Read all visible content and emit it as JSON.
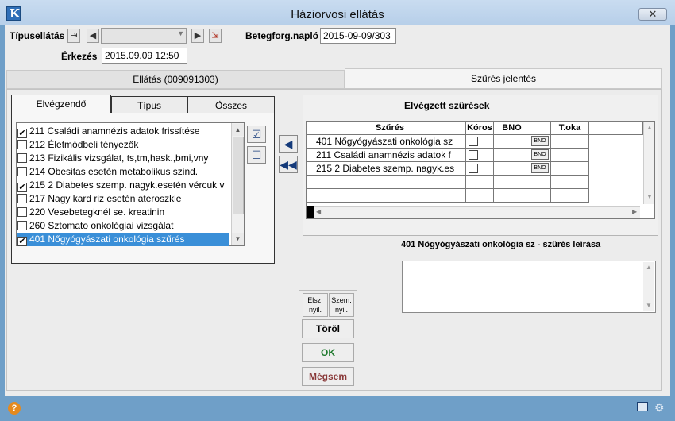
{
  "window": {
    "title": "Háziorvosi ellátás",
    "close_label": "✕"
  },
  "header": {
    "tipusellatas_label": "Típusellátás",
    "tipusellatas_value": "",
    "betegforg_label": "Betegforg.napló",
    "betegforg_value": "2015-09-09/303",
    "erkezes_label": "Érkezés",
    "erkezes_value": "2015.09.09 12:50"
  },
  "main_tabs": [
    {
      "label": "Ellátás (009091303)",
      "active": false
    },
    {
      "label": "Szűrés jelentés",
      "active": true
    }
  ],
  "sub_tabs": [
    {
      "label": "Elvégzendő",
      "active": true
    },
    {
      "label": "Típus",
      "active": false
    },
    {
      "label": "Összes",
      "active": false
    }
  ],
  "screening_list": [
    {
      "label": "211 Családi anamnézis adatok frissítése",
      "checked": true,
      "selected": false
    },
    {
      "label": "212 Életmódbeli tényezők",
      "checked": false,
      "selected": false
    },
    {
      "label": "213 Fizikális vizsgálat, ts,tm,hask.,bmi,vny",
      "checked": false,
      "selected": false
    },
    {
      "label": "214 Obesitas esetén metabolikus szind.",
      "checked": false,
      "selected": false
    },
    {
      "label": "215 2 Diabetes szemp. nagyk.esetén vércuk v",
      "checked": true,
      "selected": false
    },
    {
      "label": "217 Nagy kard riz esetén ateroszkle",
      "checked": false,
      "selected": false
    },
    {
      "label": "220 Vesebetegknél se. kreatinin",
      "checked": false,
      "selected": false
    },
    {
      "label": "260 Sztomato onkológiai vizsgálat",
      "checked": false,
      "selected": false
    },
    {
      "label": "401 Nőgyógyászati onkológia szűrés",
      "checked": true,
      "selected": true
    }
  ],
  "done": {
    "title": "Elvégzett szűrések",
    "columns": [
      "Szűrés",
      "Kóros",
      "BNO",
      "",
      "T.oka"
    ],
    "rows": [
      {
        "name": "401 Nőgyógyászati onkológia sz",
        "koros": false,
        "bno": "",
        "btn": "BNO",
        "toka": ""
      },
      {
        "name": "211 Családi anamnézis adatok f",
        "koros": false,
        "bno": "",
        "btn": "BNO",
        "toka": ""
      },
      {
        "name": "215 2 Diabetes szemp. nagyk.es",
        "koros": false,
        "bno": "",
        "btn": "BNO",
        "toka": ""
      }
    ]
  },
  "description": {
    "title": "401 Nőgyógyászati onkológia sz - szűrés leírása",
    "value": ""
  },
  "buttons": {
    "elsz_line1": "Elsz.",
    "elsz_line2": "nyil.",
    "szem_line1": "Szem.",
    "szem_line2": "nyil.",
    "torol": "Töröl",
    "ok": "OK",
    "megsem": "Mégsem"
  },
  "colors": {
    "accent_ok": "#1f7a2e",
    "accent_cancel": "#8a3a3a",
    "selection": "#3a8fd8"
  }
}
